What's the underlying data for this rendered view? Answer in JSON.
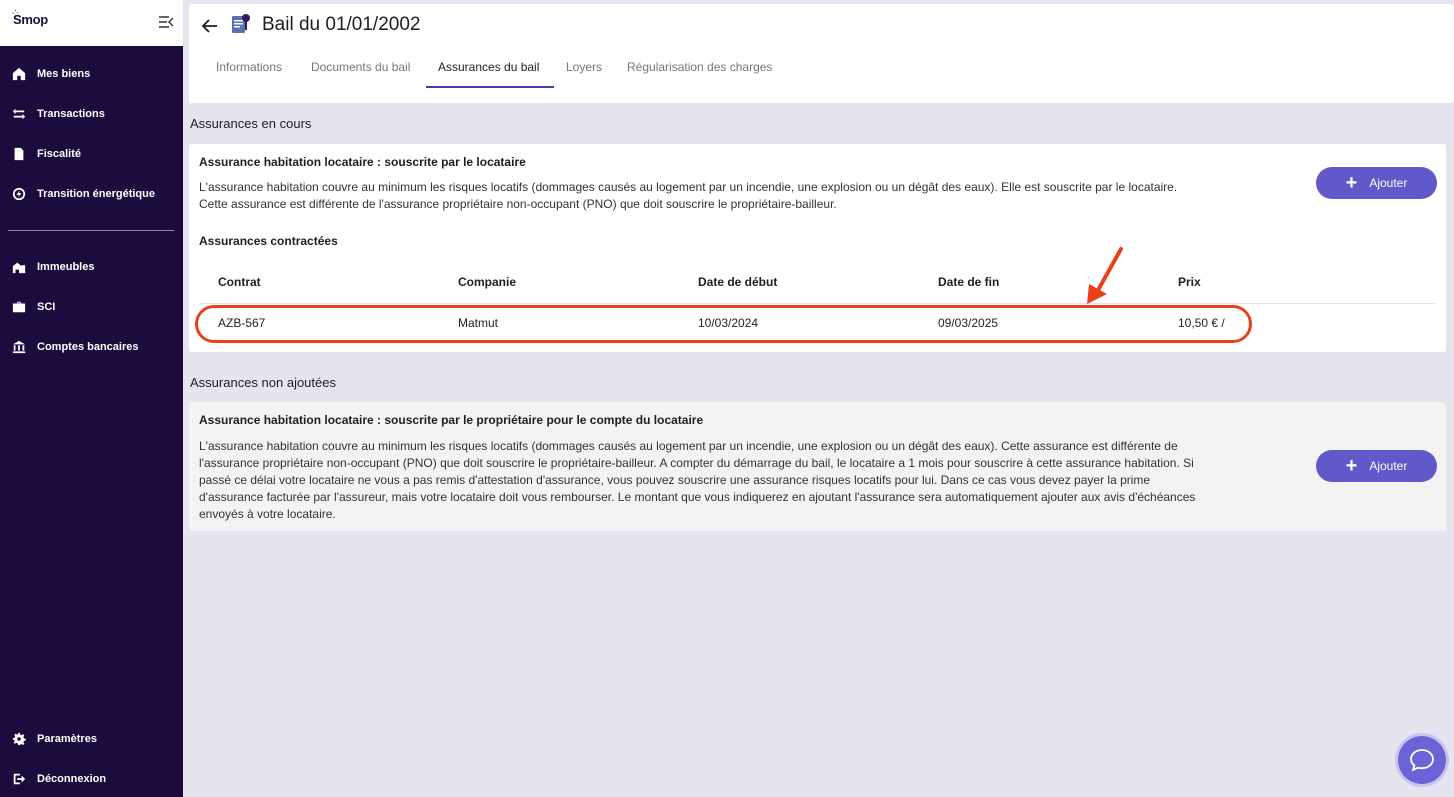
{
  "app": {
    "logo_text": "Smop"
  },
  "sidebar": {
    "items": [
      {
        "label": "Mes biens",
        "icon": "home-icon"
      },
      {
        "label": "Transactions",
        "icon": "swap-icon"
      },
      {
        "label": "Fiscalité",
        "icon": "document-icon"
      },
      {
        "label": "Transition énergétique",
        "icon": "energy-icon"
      },
      {
        "label": "Immeubles",
        "icon": "buildings-icon"
      },
      {
        "label": "SCI",
        "icon": "briefcase-icon"
      },
      {
        "label": "Comptes bancaires",
        "icon": "bank-icon"
      }
    ],
    "bottom_items": [
      {
        "label": "Paramètres",
        "icon": "gear-icon"
      },
      {
        "label": "Déconnexion",
        "icon": "logout-icon"
      }
    ]
  },
  "header": {
    "title": "Bail du 01/01/2002",
    "tabs": [
      {
        "label": "Informations",
        "active": false
      },
      {
        "label": "Documents du bail",
        "active": false
      },
      {
        "label": "Assurances du bail",
        "active": true
      },
      {
        "label": "Loyers",
        "active": false
      },
      {
        "label": "Régularisation des charges",
        "active": false
      }
    ]
  },
  "current": {
    "section_title": "Assurances en cours",
    "card_title": "Assurance habitation locataire : souscrite par le locataire",
    "description_lines": [
      "L'assurance habitation couvre au minimum les risques locatifs (dommages causés au logement par un incendie, une explosion ou un dégât des eaux). Elle est souscrite par le locataire.",
      "Cette assurance est différente de l'assurance propriétaire non-occupant (PNO) que doit souscrire le propriétaire-bailleur."
    ],
    "add_label": "Ajouter",
    "contracts_title": "Assurances contractées",
    "table": {
      "headers": [
        "Contrat",
        "Companie",
        "Date de début",
        "Date de fin",
        "Prix"
      ],
      "rows": [
        [
          "AZB-567",
          "Matmut",
          "10/03/2024",
          "09/03/2025",
          "10,50 € /"
        ]
      ]
    }
  },
  "not_added": {
    "section_title": "Assurances non ajoutées",
    "card_title": "Assurance habitation locataire : souscrite par le propriétaire pour le compte du locataire",
    "description_lines": [
      "L'assurance habitation couvre au minimum les risques locatifs (dommages causés au logement par un incendie, une explosion ou un dégât des eaux). Cette assurance est différente de",
      "l'assurance propriétaire non-occupant (PNO) que doit souscrire le propriétaire-bailleur. A compter du démarrage du bail, le locataire a 1 mois pour souscrire à cette assurance habitation. Si",
      "passé ce délai votre locataire ne vous a pas remis d'attestation d'assurance, vous pouvez souscrire une assurance risques locatifs pour lui. Dans ce cas vous devez payer la prime",
      "d'assurance facturée par l'assureur, mais votre locataire doit vous rembourser. Le montant que vous indiquerez en ajoutant l'assurance sera automatiquement ajouter aux avis d'échéances",
      "envoyés à votre locataire."
    ],
    "add_label": "Ajouter"
  },
  "colors": {
    "sidebar_bg": "#1c0c3d",
    "accent": "#6158c9",
    "highlight": "#e8401c",
    "page_bg": "#e6e4ef"
  }
}
